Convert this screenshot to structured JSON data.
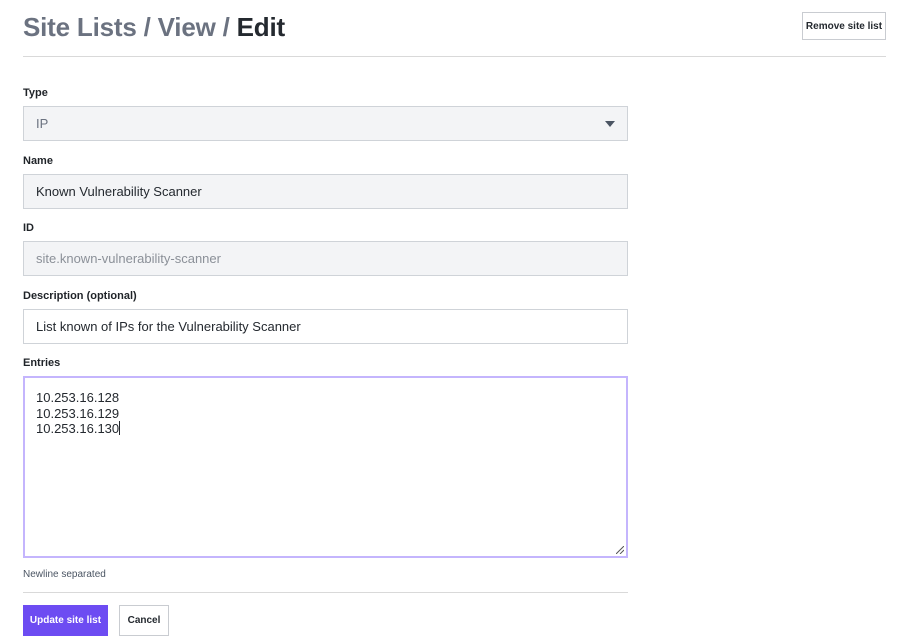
{
  "breadcrumb": {
    "items": [
      "Site Lists",
      "View"
    ],
    "current": "Edit",
    "separator": "/"
  },
  "header": {
    "remove_label": "Remove site list"
  },
  "form": {
    "type": {
      "label": "Type",
      "value": "IP"
    },
    "name": {
      "label": "Name",
      "value": "Known Vulnerability Scanner"
    },
    "id": {
      "label": "ID",
      "value": "site.known-vulnerability-scanner"
    },
    "description": {
      "label": "Description (optional)",
      "value": "List known of IPs for the Vulnerability Scanner"
    },
    "entries": {
      "label": "Entries",
      "lines": [
        "10.253.16.128",
        "10.253.16.129",
        "10.253.16.130"
      ],
      "help": "Newline separated"
    }
  },
  "actions": {
    "update_label": "Update site list",
    "cancel_label": "Cancel"
  },
  "colors": {
    "primary": "#6d4cf2",
    "focus_border": "#c4b5fd",
    "field_grey": "#f3f4f6"
  },
  "icons": {
    "dropdown": "chevron-down-icon",
    "resize": "resize-handle-icon"
  }
}
